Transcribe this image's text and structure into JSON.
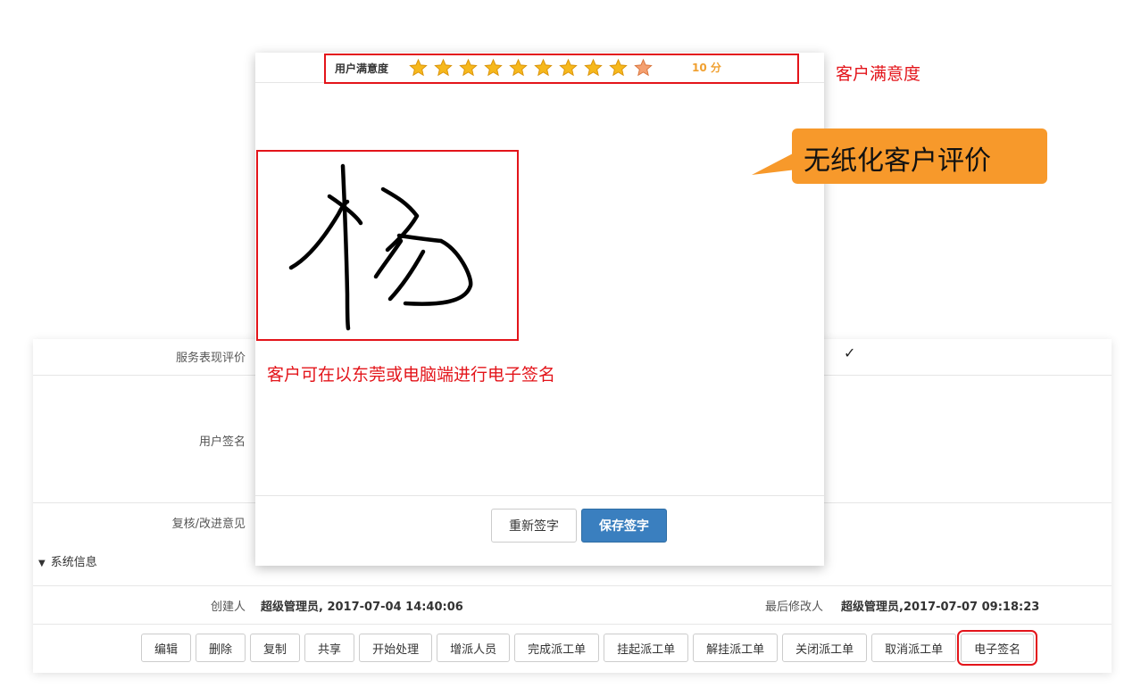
{
  "modal": {
    "rating_label": "用户满意度",
    "rating_value": 10,
    "rating_max": 10,
    "score_text": "10 分",
    "signature_note": "客户可在以东莞或电脑端进行电子签名",
    "reset_button": "重新签字",
    "save_button": "保存签字"
  },
  "annotations": {
    "satisfaction_label": "客户满意度",
    "callout_text": "无纸化客户评价"
  },
  "form": {
    "service_label": "服务表现评价",
    "check_prefix": "：",
    "check_mark": "✓",
    "sign_label": "用户签名",
    "review_label": "复核/改进意见",
    "system_info": "系统信息",
    "creator_label": "创建人",
    "creator_value": "超级管理员, 2017-07-04 14:40:06",
    "modifier_label": "最后修改人",
    "modifier_value": "超级管理员,2017-07-07 09:18:23"
  },
  "buttons": [
    {
      "label": "编辑",
      "name": "edit-button"
    },
    {
      "label": "删除",
      "name": "delete-button"
    },
    {
      "label": "复制",
      "name": "copy-button"
    },
    {
      "label": "共享",
      "name": "share-button"
    },
    {
      "label": "开始处理",
      "name": "start-processing-button"
    },
    {
      "label": "增派人员",
      "name": "add-staff-button"
    },
    {
      "label": "完成派工单",
      "name": "complete-order-button"
    },
    {
      "label": "挂起派工单",
      "name": "suspend-order-button"
    },
    {
      "label": "解挂派工单",
      "name": "resume-order-button"
    },
    {
      "label": "关闭派工单",
      "name": "close-order-button"
    },
    {
      "label": "取消派工单",
      "name": "cancel-order-button"
    },
    {
      "label": "电子签名",
      "name": "e-signature-button"
    }
  ],
  "colors": {
    "accent_red": "#e3141a",
    "callout_orange": "#f7992b",
    "primary_blue": "#3a7fbf",
    "star_gold": "#f6b81c"
  }
}
